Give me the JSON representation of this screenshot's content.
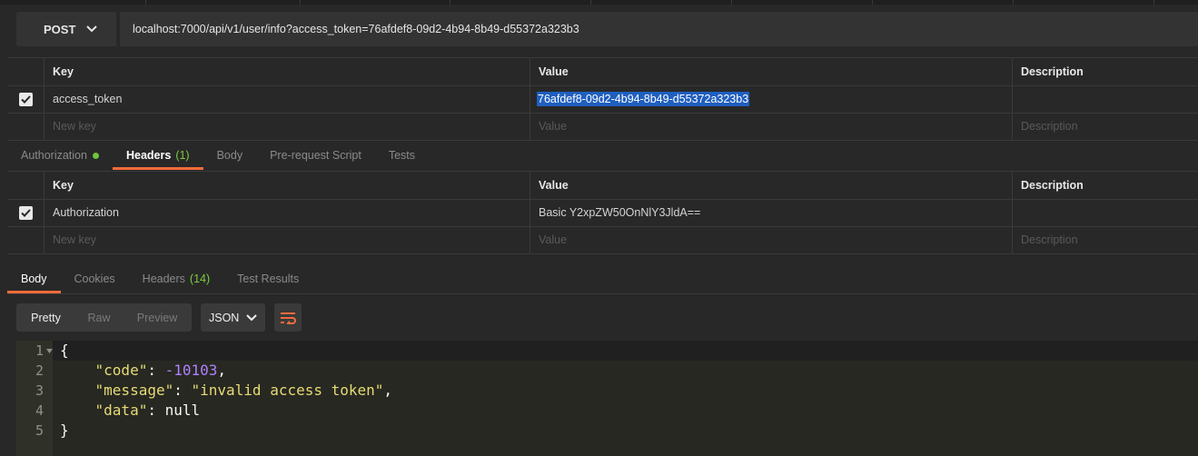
{
  "request": {
    "method": "POST",
    "url": "localhost:7000/api/v1/user/info?access_token=76afdef8-09d2-4b94-8b49-d55372a323b3"
  },
  "params_table": {
    "headers": [
      "Key",
      "Value",
      "Description"
    ],
    "rows": [
      {
        "key": "access_token",
        "value": "76afdef8-09d2-4b94-8b49-d55372a323b3",
        "description": ""
      }
    ],
    "placeholder": {
      "key": "New key",
      "value": "Value",
      "description": "Description"
    }
  },
  "request_tabs": [
    {
      "label": "Authorization"
    },
    {
      "label": "Headers",
      "count": "(1)"
    },
    {
      "label": "Body"
    },
    {
      "label": "Pre-request Script"
    },
    {
      "label": "Tests"
    }
  ],
  "headers_table": {
    "headers": [
      "Key",
      "Value",
      "Description"
    ],
    "rows": [
      {
        "key": "Authorization",
        "value": "Basic Y2xpZW50OnNlY3JldA==",
        "description": ""
      }
    ],
    "placeholder": {
      "key": "New key",
      "value": "Value",
      "description": "Description"
    }
  },
  "response_tabs": [
    {
      "label": "Body"
    },
    {
      "label": "Cookies"
    },
    {
      "label": "Headers",
      "count": "(14)"
    },
    {
      "label": "Test Results"
    }
  ],
  "view_modes": [
    "Pretty",
    "Raw",
    "Preview"
  ],
  "format": "JSON",
  "response_body": {
    "line_numbers": [
      "1",
      "2",
      "3",
      "4",
      "5"
    ],
    "open_brace": "{",
    "close_brace": "}",
    "code_key": "\"code\"",
    "code_value": "-10103",
    "message_key": "\"message\"",
    "message_value": "\"invalid access token\"",
    "data_key": "\"data\"",
    "data_value": "null"
  },
  "colors": {
    "accent": "#f26b3a",
    "status_dot": "#6fc33a",
    "selection": "#1f5fbf"
  }
}
